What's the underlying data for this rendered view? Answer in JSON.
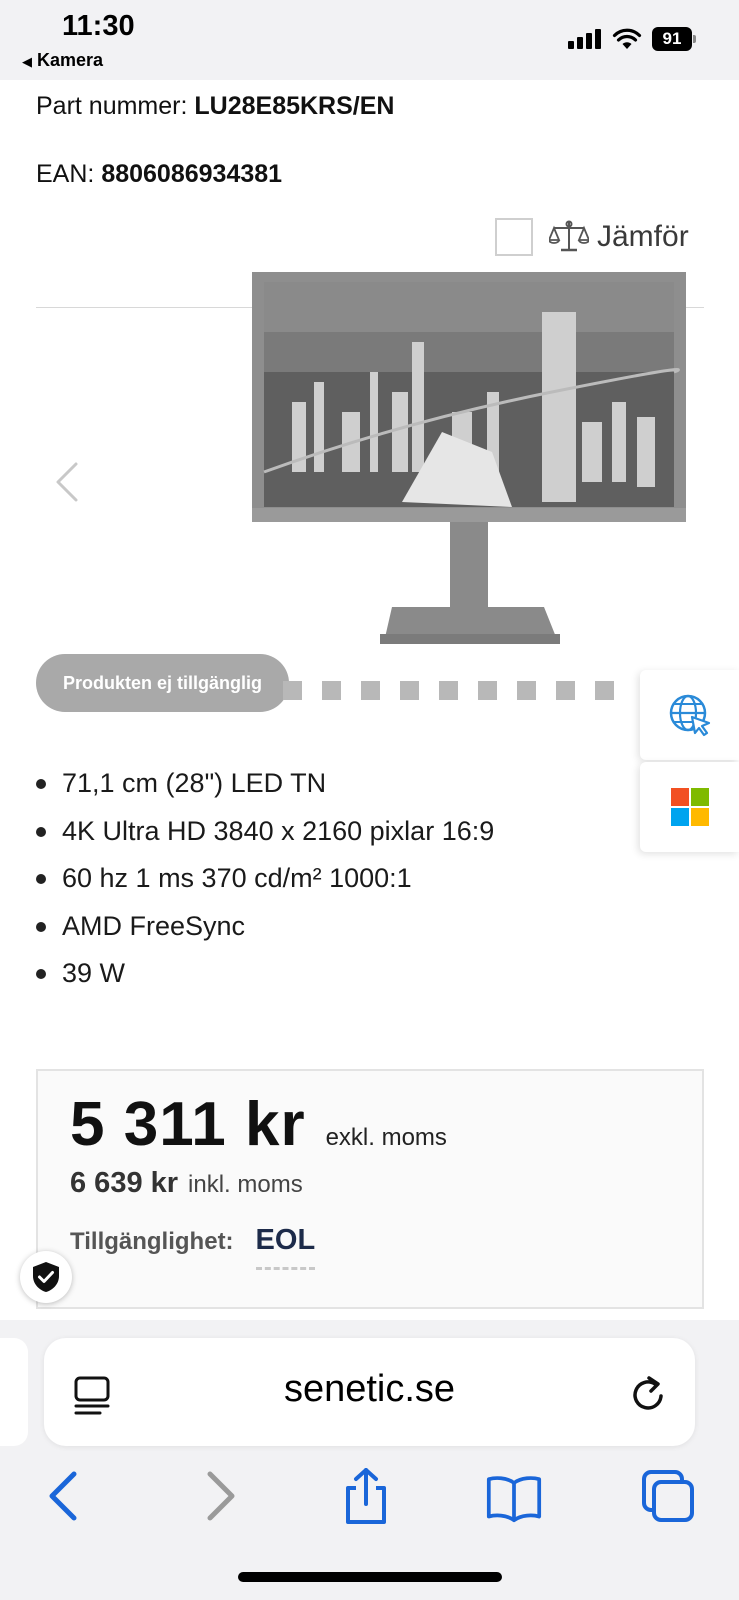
{
  "status_bar": {
    "time": "11:30",
    "back_app": "Kamera",
    "battery": "91"
  },
  "product": {
    "part_label": "Part nummer:",
    "part_number": "LU28E85KRS/EN",
    "ean_label": "EAN:",
    "ean": "8806086934381",
    "compare_label": "Jämför",
    "unavailable_label": "Produkten ej tillgänglig",
    "features": [
      "71,1 cm (28\") LED TN",
      "4K Ultra HD 3840 x 2160 pixlar 16:9",
      "60 hz 1 ms 370 cd/m² 1000:1",
      "AMD FreeSync",
      "39 W"
    ]
  },
  "pricing": {
    "price_excl": "5 311 kr",
    "excl_label": "exkl. moms",
    "price_incl": "6 639 kr",
    "incl_label": "inkl. moms",
    "availability_label": "Tillgänglighet:",
    "availability_value": "EOL"
  },
  "browser": {
    "url": "senetic.se"
  },
  "colors": {
    "accent": "#1a66d9",
    "unavailable_bg": "#a9a9a9",
    "eol_text": "#1d2b4a"
  }
}
